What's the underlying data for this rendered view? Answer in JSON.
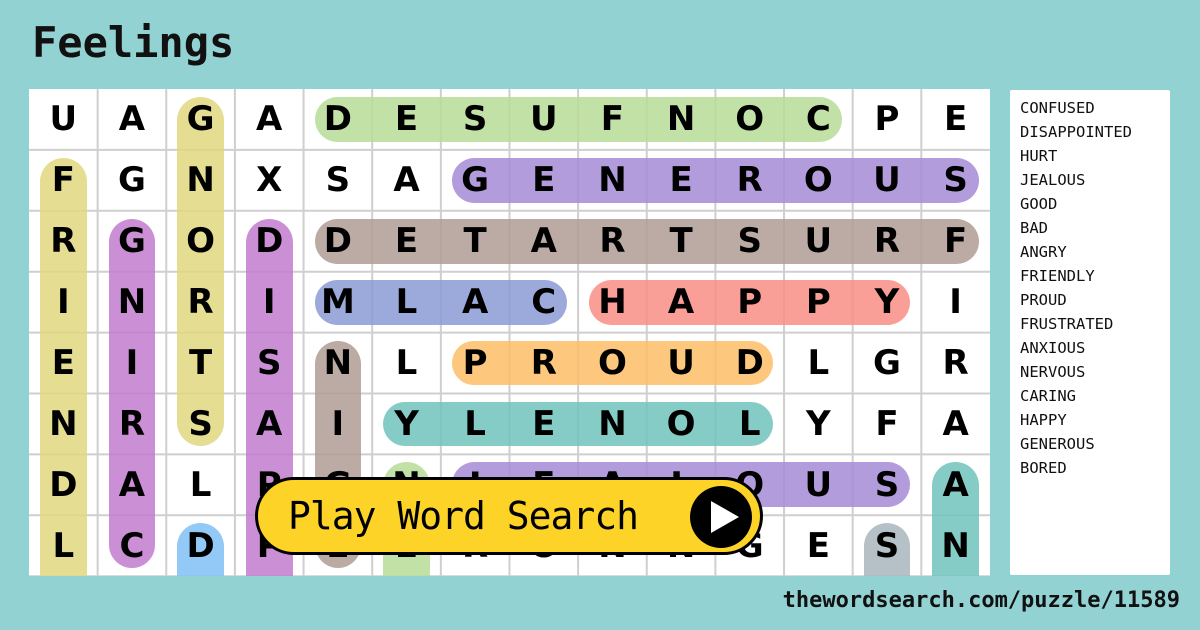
{
  "title": "Feelings",
  "grid": {
    "rows": [
      [
        "U",
        "A",
        "G",
        "A",
        "D",
        "E",
        "S",
        "U",
        "F",
        "N",
        "O",
        "C",
        "P",
        "E"
      ],
      [
        "F",
        "G",
        "N",
        "X",
        "S",
        "A",
        "G",
        "E",
        "N",
        "E",
        "R",
        "O",
        "U",
        "S"
      ],
      [
        "R",
        "G",
        "O",
        "D",
        "D",
        "E",
        "T",
        "A",
        "R",
        "T",
        "S",
        "U",
        "R",
        "F"
      ],
      [
        "I",
        "N",
        "R",
        "I",
        "M",
        "L",
        "A",
        "C",
        "H",
        "A",
        "P",
        "P",
        "Y",
        "I"
      ],
      [
        "E",
        "I",
        "T",
        "S",
        "N",
        "L",
        "P",
        "R",
        "O",
        "U",
        "D",
        "L",
        "G",
        "R"
      ],
      [
        "N",
        "R",
        "S",
        "A",
        "I",
        "Y",
        "L",
        "E",
        "N",
        "O",
        "L",
        "Y",
        "F",
        "A"
      ],
      [
        "D",
        "A",
        "L",
        "P",
        "G",
        "N",
        "J",
        "E",
        "A",
        "L",
        "O",
        "U",
        "S",
        "A"
      ],
      [
        "L",
        "C",
        "D",
        "P",
        "E",
        "E",
        "R",
        "O",
        "N",
        "N",
        "G",
        "E",
        "S",
        "N"
      ]
    ],
    "highlights": [
      {
        "word": "CONFUSED",
        "color": "#b7dc98",
        "r1": 0,
        "c1": 4,
        "r2": 0,
        "c2": 11
      },
      {
        "word": "GENEROUS",
        "color": "#a58bd6",
        "r1": 1,
        "c1": 6,
        "r2": 1,
        "c2": 13
      },
      {
        "word": "FRUSTRATED",
        "color": "#b09c94",
        "r1": 2,
        "c1": 4,
        "r2": 2,
        "c2": 13
      },
      {
        "word": "CALM",
        "color": "#8a9bd4",
        "r1": 3,
        "c1": 4,
        "r2": 3,
        "c2": 7
      },
      {
        "word": "HAPPY",
        "color": "#f98e86",
        "r1": 3,
        "c1": 8,
        "r2": 3,
        "c2": 12
      },
      {
        "word": "PROUD",
        "color": "#fdbd67",
        "r1": 4,
        "c1": 6,
        "r2": 4,
        "c2": 10
      },
      {
        "word": "LONELY",
        "color": "#6ec3bb",
        "r1": 5,
        "c1": 5,
        "r2": 5,
        "c2": 10
      },
      {
        "word": "JEALOUS",
        "color": "#a58bd6",
        "r1": 6,
        "c1": 6,
        "r2": 6,
        "c2": 12
      },
      {
        "word": "FRIENDLY",
        "color": "#e0d77f",
        "r1": 1,
        "c1": 0,
        "r2": 8,
        "c2": 0
      },
      {
        "word": "CARING",
        "color": "#c27bcf",
        "r1": 2,
        "c1": 1,
        "r2": 7,
        "c2": 1
      },
      {
        "word": "GOOD",
        "color": "#e0d77f",
        "r1": 0,
        "c1": 2,
        "r2": 5,
        "c2": 2
      },
      {
        "word": "DISAPPOINTED",
        "color": "#c27bcf",
        "r1": 2,
        "c1": 3,
        "r2": 8,
        "c2": 3
      },
      {
        "word": "NIG",
        "color": "#b09c94",
        "r1": 4,
        "c1": 4,
        "r2": 7,
        "c2": 4
      },
      {
        "word": "SAD",
        "color": "#a9b6bd",
        "r1": 7,
        "c1": 12,
        "r2": 8,
        "c2": 12
      },
      {
        "word": "AN",
        "color": "#6ec3bb",
        "r1": 6,
        "c1": 13,
        "r2": 8,
        "c2": 13
      },
      {
        "word": "D",
        "color": "#7fbff5",
        "r1": 7,
        "c1": 2,
        "r2": 8,
        "c2": 2
      },
      {
        "word": "N",
        "color": "#b7dc98",
        "r1": 6,
        "c1": 5,
        "r2": 8,
        "c2": 5
      }
    ]
  },
  "word_list": [
    "CONFUSED",
    "DISAPPOINTED",
    "HURT",
    "JEALOUS",
    "GOOD",
    "BAD",
    "ANGRY",
    "FRIENDLY",
    "PROUD",
    "FRUSTRATED",
    "ANXIOUS",
    "NERVOUS",
    "CARING",
    "HAPPY",
    "GENEROUS",
    "BORED"
  ],
  "play_button": {
    "label": "Play Word Search",
    "icon": "play-icon"
  },
  "footer": {
    "url": "thewordsearch.com/puzzle/11589"
  }
}
